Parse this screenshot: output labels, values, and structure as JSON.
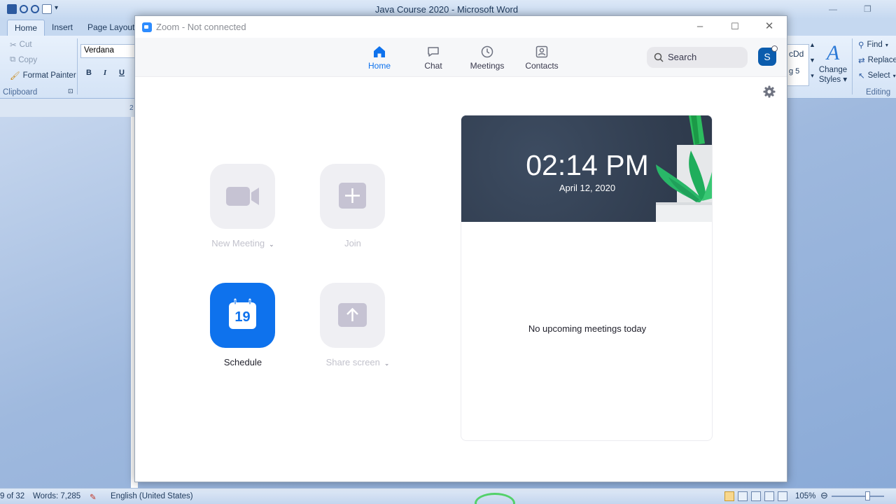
{
  "word": {
    "title": "Java Course 2020 - Microsoft Word",
    "tabs": [
      "Home",
      "Insert",
      "Page Layout"
    ],
    "clipboard": {
      "cut": "Cut",
      "copy": "Copy",
      "format_painter": "Format Painter",
      "group_label": "Clipboard"
    },
    "font_name": "Verdana",
    "format_buttons": [
      "B",
      "I",
      "U"
    ],
    "styles_preview": "cDd",
    "styles_heading": "g 5",
    "change_styles": [
      "Change",
      "Styles"
    ],
    "editing": {
      "find": "Find",
      "replace": "Replace",
      "select": "Select",
      "group_label": "Editing"
    },
    "ruler_mark": "2",
    "status": {
      "page": "9 of 32",
      "words": "Words: 7,285",
      "language": "English (United States)",
      "zoom": "105%"
    }
  },
  "zoom": {
    "title": "Zoom - Not connected",
    "nav": [
      {
        "label": "Home",
        "icon": "home-icon",
        "active": true
      },
      {
        "label": "Chat",
        "icon": "chat-icon",
        "active": false
      },
      {
        "label": "Meetings",
        "icon": "clock-icon",
        "active": false
      },
      {
        "label": "Contacts",
        "icon": "contacts-icon",
        "active": false
      }
    ],
    "search_label": "Search",
    "avatar_initial": "S",
    "actions": {
      "new_meeting": "New Meeting",
      "join": "Join",
      "schedule": "Schedule",
      "schedule_day": "19",
      "share_screen": "Share screen"
    },
    "clock": {
      "time": "02:14 PM",
      "date": "April 12, 2020"
    },
    "no_meetings": "No upcoming meetings today",
    "colors": {
      "accent": "#0e72ed",
      "hero": "#344255",
      "avatar": "#0b5cad"
    }
  }
}
